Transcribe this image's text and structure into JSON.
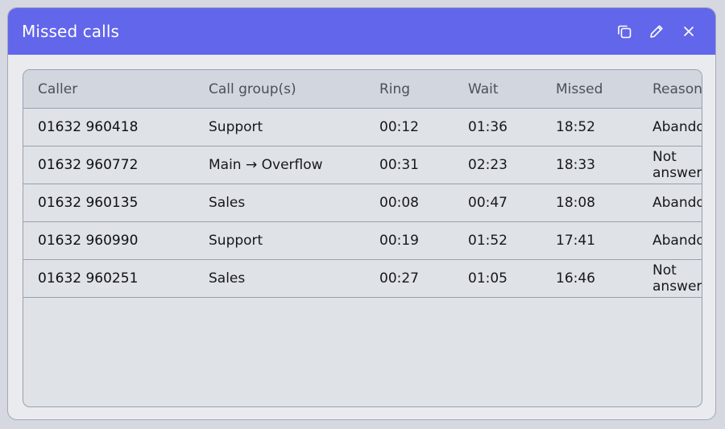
{
  "window": {
    "title": "Missed calls",
    "colors": {
      "titlebar": "#6266eb",
      "title_text": "#ffffff",
      "panel_bg": "#dfe2e7",
      "header_bg": "#d2d6de"
    },
    "actions": [
      {
        "icon": "copy-icon"
      },
      {
        "icon": "pencil-icon"
      },
      {
        "icon": "close-icon"
      }
    ]
  },
  "table": {
    "columns": [
      "Caller",
      "Call group(s)",
      "Ring",
      "Wait",
      "Missed",
      "Reason"
    ],
    "rows": [
      [
        "01632 960418",
        "Support",
        "00:12",
        "01:36",
        "18:52",
        "Abandoned"
      ],
      [
        "01632 960772",
        "Main → Overflow",
        "00:31",
        "02:23",
        "18:33",
        "Not answered"
      ],
      [
        "01632 960135",
        "Sales",
        "00:08",
        "00:47",
        "18:08",
        "Abandoned"
      ],
      [
        "01632 960990",
        "Support",
        "00:19",
        "01:52",
        "17:41",
        "Abandoned"
      ],
      [
        "01632 960251",
        "Sales",
        "00:27",
        "01:05",
        "16:46",
        "Not answered"
      ]
    ]
  }
}
